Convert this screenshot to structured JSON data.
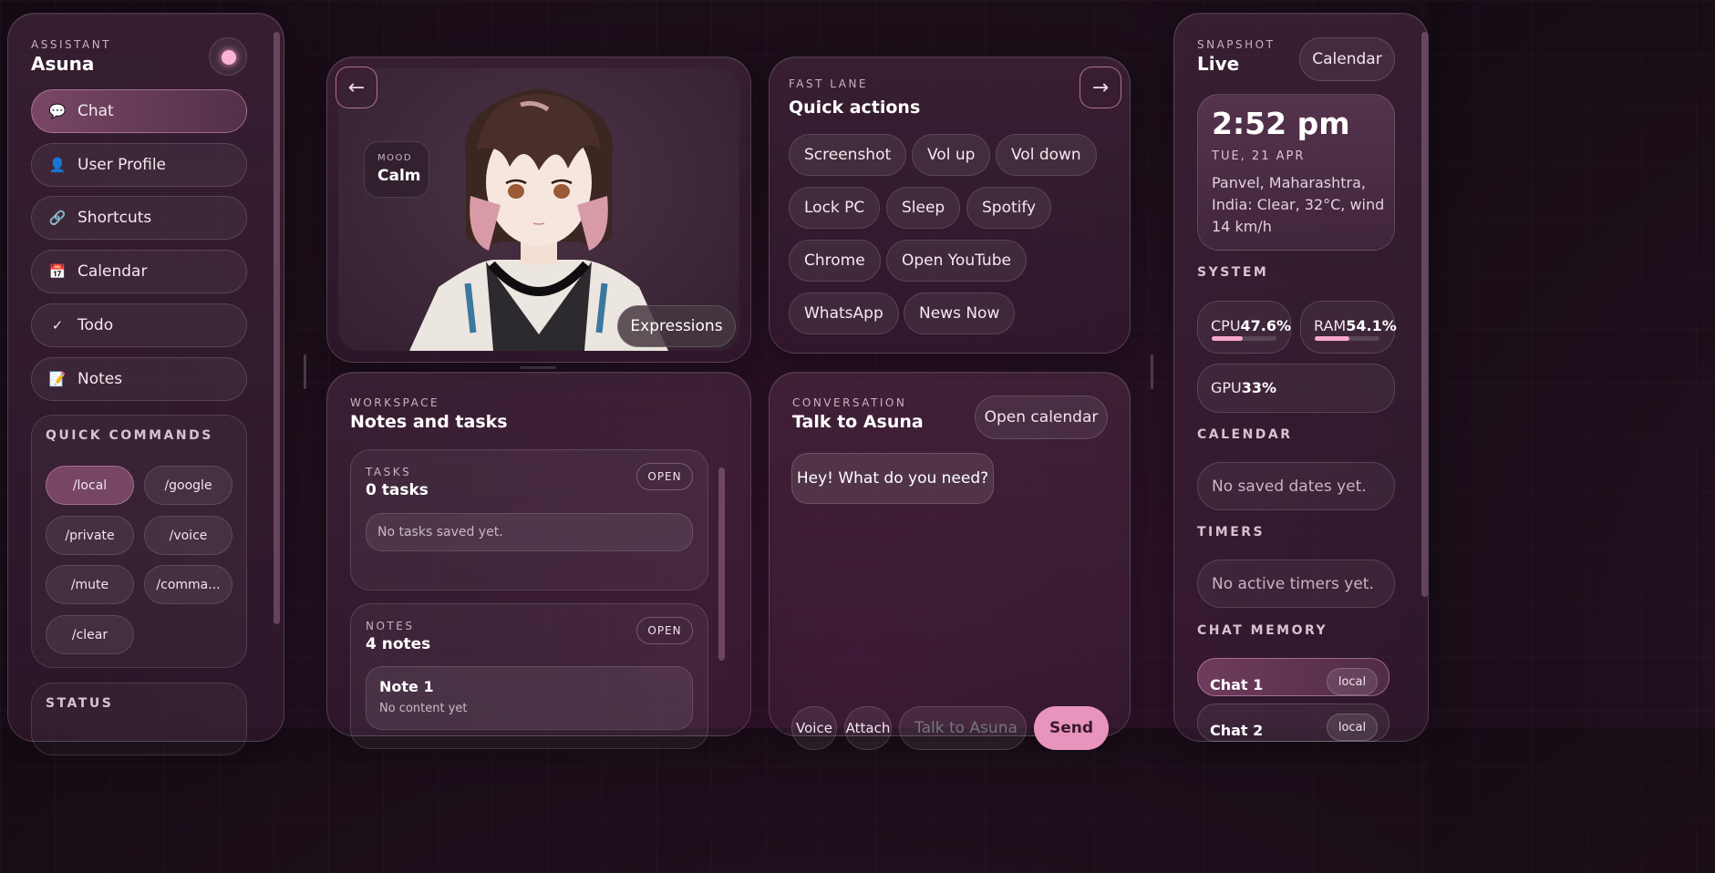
{
  "assistant": {
    "eyebrow": "ASSISTANT",
    "name": "Asuna"
  },
  "nav": [
    {
      "label": "Chat",
      "icon": "speech-bubble-icon",
      "glyph": "💬"
    },
    {
      "label": "User Profile",
      "icon": "user-icon",
      "glyph": "👤"
    },
    {
      "label": "Shortcuts",
      "icon": "link-icon",
      "glyph": "🔗"
    },
    {
      "label": "Calendar",
      "icon": "calendar-icon",
      "glyph": "📅"
    },
    {
      "label": "Todo",
      "icon": "check-icon",
      "glyph": "✓"
    },
    {
      "label": "Notes",
      "icon": "memo-icon",
      "glyph": "📝"
    }
  ],
  "quick_commands": {
    "heading": "QUICK COMMANDS",
    "items": [
      "/local",
      "/google",
      "/private",
      "/voice",
      "/mute",
      "/comma...",
      "/clear"
    ]
  },
  "status": {
    "heading": "STATUS"
  },
  "avatar": {
    "mood_label": "MOOD",
    "mood_value": "Calm",
    "expressions_label": "Expressions",
    "prev_glyph": "←",
    "next_glyph": "→"
  },
  "quick_actions": {
    "eyebrow": "FAST LANE",
    "title": "Quick actions",
    "items": [
      "Screenshot",
      "Vol up",
      "Vol down",
      "Lock PC",
      "Sleep",
      "Spotify",
      "Chrome",
      "Open YouTube",
      "WhatsApp",
      "News Now"
    ]
  },
  "workspace": {
    "eyebrow": "WORKSPACE",
    "title": "Notes and tasks",
    "tasks": {
      "eyebrow": "TASKS",
      "title": "0 tasks",
      "open_label": "OPEN",
      "empty": "No tasks saved yet."
    },
    "notes": {
      "eyebrow": "NOTES",
      "title": "4 notes",
      "open_label": "OPEN",
      "first_note_title": "Note 1",
      "first_note_body": "No content yet"
    }
  },
  "conversation": {
    "eyebrow": "CONVERSATION",
    "title": "Talk to Asuna",
    "open_calendar_label": "Open calendar",
    "messages": [
      "Hey! What do you need?"
    ],
    "voice_label": "Voice",
    "attach_label": "Attach",
    "input_placeholder": "Talk to Asuna",
    "send_label": "Send"
  },
  "snapshot": {
    "eyebrow": "SNAPSHOT",
    "title": "Live",
    "calendar_label": "Calendar",
    "time": "2:52 pm",
    "date": "TUE, 21 APR",
    "weather": "Panvel, Maharashtra, India: Clear, 32°C, wind 14 km/h"
  },
  "system": {
    "heading": "SYSTEM",
    "cpu_label": "CPU",
    "cpu_value": "47.6%",
    "cpu_fraction": 0.476,
    "ram_label": "RAM",
    "ram_value": "54.1%",
    "ram_fraction": 0.541,
    "gpu_label": "GPU",
    "gpu_value": "33%"
  },
  "calendar": {
    "heading": "CALENDAR",
    "empty": "No saved dates yet."
  },
  "timers": {
    "heading": "TIMERS",
    "empty": "No active timers yet."
  },
  "chat_memory": {
    "heading": "CHAT MEMORY",
    "items": [
      {
        "title": "Chat 1",
        "tag": "local"
      },
      {
        "title": "Chat 2",
        "tag": "local"
      }
    ]
  },
  "colors": {
    "accent_pink": "#e894bc",
    "status_dot": "#ffb3d2",
    "background": "#1d0f1b"
  }
}
